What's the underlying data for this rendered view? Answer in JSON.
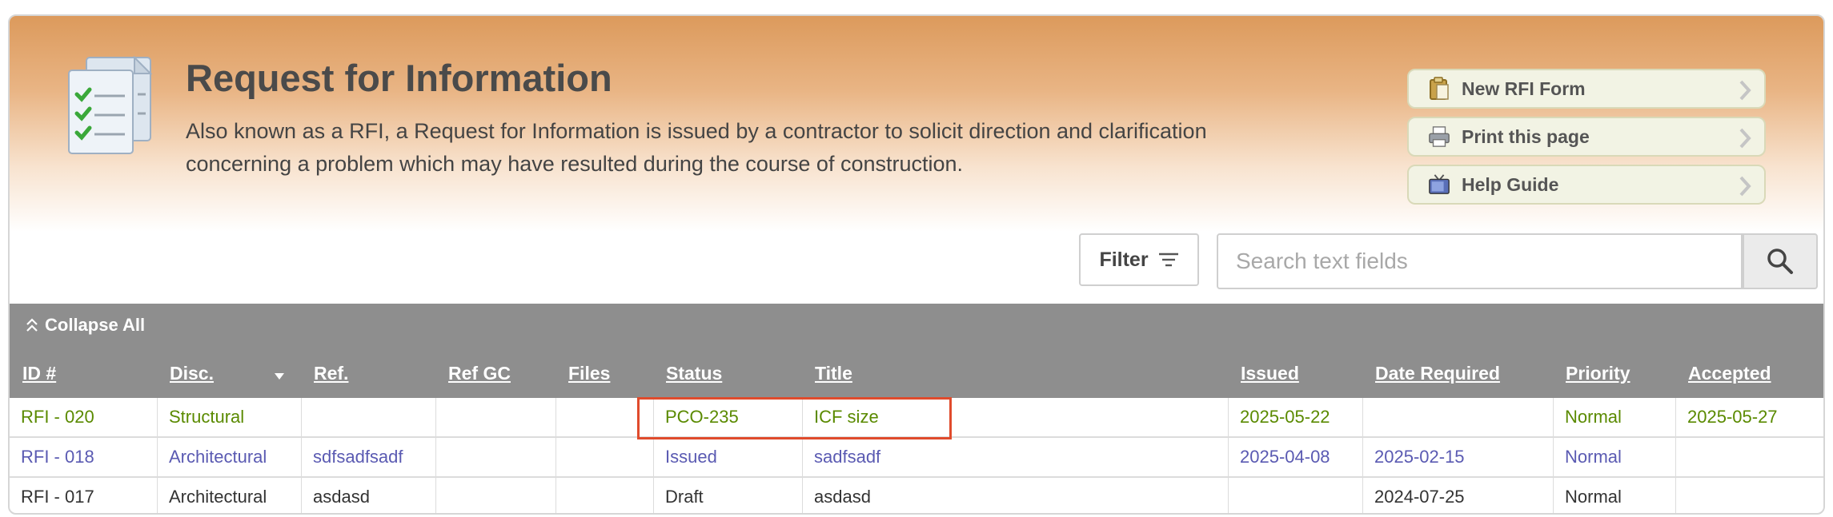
{
  "header": {
    "title": "Request for Information",
    "description": "Also known as a RFI, a Request for Information is issued by a contractor to solicit direction and clarification concerning a problem which may have resulted during the course of construction.",
    "icon": "checklist-document-icon"
  },
  "actions": [
    {
      "label": "New RFI Form",
      "icon": "clipboard-icon"
    },
    {
      "label": "Print this page",
      "icon": "printer-icon"
    },
    {
      "label": "Help Guide",
      "icon": "tv-icon"
    }
  ],
  "toolbar": {
    "filter_label": "Filter",
    "search_placeholder": "Search text fields",
    "search_value": ""
  },
  "grid": {
    "collapse_label": "Collapse All",
    "columns": [
      "ID #",
      "Disc.",
      "Ref.",
      "Ref GC",
      "Files",
      "Status",
      "Title",
      "Issued",
      "Date Required",
      "Priority",
      "Accepted"
    ],
    "rows": [
      {
        "color": "green",
        "cells": [
          "RFI - 020",
          "Structural",
          "",
          "",
          "",
          "PCO-235",
          "ICF size",
          "2025-05-22",
          "",
          "Normal",
          "2025-05-27"
        ]
      },
      {
        "color": "blue",
        "cells": [
          "RFI - 018",
          "Architectural",
          "sdfsadfsadf",
          "",
          "",
          "Issued",
          "sadfsadf",
          "2025-04-08",
          "2025-02-15",
          "Normal",
          ""
        ]
      },
      {
        "color": "black",
        "cells": [
          "RFI - 017",
          "Architectural",
          "asdasd",
          "",
          "",
          "Draft",
          "asdasd",
          "",
          "2024-07-25",
          "Normal",
          ""
        ]
      }
    ]
  },
  "colors": {
    "header_orange": "#dc9a5c",
    "grid_header": "#8e8e8e",
    "row_green": "#5a8a00",
    "row_blue": "#5a5ab2",
    "highlight_red": "#e04b2c"
  }
}
